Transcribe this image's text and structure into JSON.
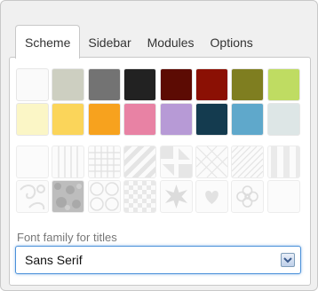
{
  "tabs": [
    "Scheme",
    "Sidebar",
    "Modules",
    "Options"
  ],
  "active_tab": "Scheme",
  "color_swatches": [
    "#fafafa",
    "#cdcfc1",
    "#737373",
    "#222222",
    "#5c0b03",
    "#8b1004",
    "#7f7e20",
    "#bfdc62",
    "#fbf6c6",
    "#fbd55a",
    "#f7a21e",
    "#e882a4",
    "#b79ad6",
    "#143b4f",
    "#5fa8cb",
    "#dde6e6"
  ],
  "patterns": [
    "blank-pattern",
    "vertical-lines-pattern",
    "grid-pattern",
    "diagonal-stripes-pattern",
    "squares-corner-pattern",
    "diamond-pattern",
    "fine-diagonal-pattern",
    "wide-stripes-pattern",
    "swirl-pattern",
    "dark-texture-pattern",
    "circles-pattern",
    "checker-pattern",
    "star-pattern",
    "heart-pattern",
    "flower-pattern",
    "blank-pattern"
  ],
  "font_family": {
    "label": "Font family for titles",
    "value": "Sans Serif"
  }
}
